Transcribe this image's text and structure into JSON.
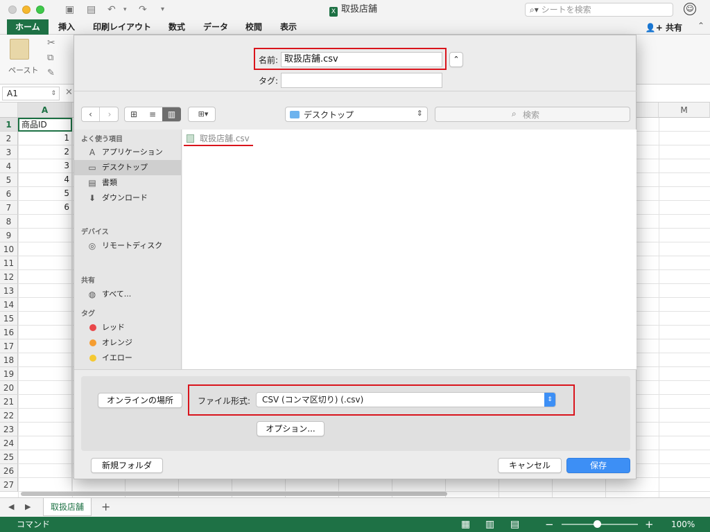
{
  "window": {
    "title": "取扱店舗"
  },
  "search": {
    "placeholder": "シートを検索"
  },
  "ribbon": {
    "tabs": [
      "ホーム",
      "挿入",
      "印刷レイアウト",
      "数式",
      "データ",
      "校閲",
      "表示"
    ],
    "share_label": "共有",
    "paste_label": "ペースト"
  },
  "formula_bar": {
    "cell_ref": "A1"
  },
  "sheet": {
    "columns": [
      "A",
      "M"
    ],
    "rows": [
      "1",
      "2",
      "3",
      "4",
      "5",
      "6",
      "7",
      "8",
      "9",
      "10",
      "11",
      "12",
      "13",
      "14",
      "15",
      "16",
      "17",
      "18",
      "19",
      "20",
      "21",
      "22",
      "23",
      "24",
      "25",
      "26",
      "27"
    ],
    "cells_a": [
      "商品ID",
      "1",
      "2",
      "3",
      "4",
      "5",
      "6"
    ],
    "sheet_tab": "取扱店舗"
  },
  "status": {
    "mode": "コマンド",
    "zoom": "100%"
  },
  "dialog": {
    "name_label": "名前:",
    "name_value": "取扱店舗.csv",
    "tag_label": "タグ:",
    "location": "デスクトップ",
    "search_placeholder": "検索",
    "sidebar": {
      "favorites_header": "よく使う項目",
      "favorites": [
        "アプリケーション",
        "デスクトップ",
        "書類",
        "ダウンロード"
      ],
      "devices_header": "デバイス",
      "devices": [
        "リモートディスク"
      ],
      "shared_header": "共有",
      "shared": [
        "すべて..."
      ],
      "tags_header": "タグ",
      "tags": [
        {
          "label": "レッド",
          "color": "#e9474a"
        },
        {
          "label": "オレンジ",
          "color": "#f59d31"
        },
        {
          "label": "イエロー",
          "color": "#f5c932"
        }
      ]
    },
    "files": [
      "取扱店舗.csv"
    ],
    "online_button": "オンラインの場所",
    "format_label": "ファイル形式:",
    "format_value": "CSV (コンマ区切り) (.csv)",
    "options_button": "オプション...",
    "new_folder_button": "新規フォルダ",
    "cancel_button": "キャンセル",
    "save_button": "保存"
  },
  "colors": {
    "excel_green": "#1e7145",
    "highlight_red": "#d9141c",
    "save_blue": "#3d8ff5"
  }
}
